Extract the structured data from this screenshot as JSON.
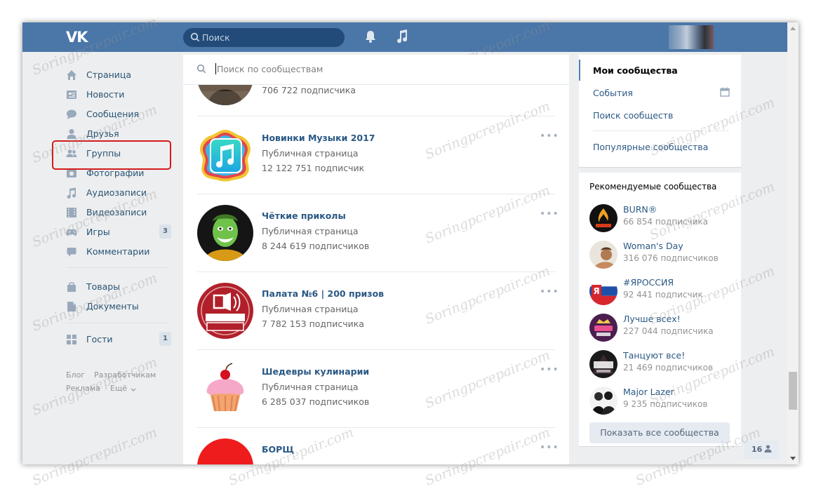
{
  "header": {
    "logo": "VK",
    "search_placeholder": "Поиск"
  },
  "nav": {
    "items": [
      {
        "label": "Страница",
        "icon": "home-icon",
        "y": 0
      },
      {
        "label": "Новости",
        "icon": "news-icon"
      },
      {
        "label": "Сообщения",
        "icon": "messages-icon"
      },
      {
        "label": "Друзья",
        "icon": "friends-icon"
      },
      {
        "label": "Группы",
        "icon": "groups-icon"
      },
      {
        "label": "Фотографии",
        "icon": "photos-icon"
      },
      {
        "label": "Аудиозаписи",
        "icon": "music-icon"
      },
      {
        "label": "Видеозаписи",
        "icon": "video-icon"
      },
      {
        "label": "Игры",
        "icon": "games-icon",
        "badge": "3"
      },
      {
        "label": "Комментарии",
        "icon": "comments-icon"
      },
      {
        "label": "Товары",
        "icon": "goods-icon"
      },
      {
        "label": "Документы",
        "icon": "documents-icon"
      },
      {
        "label": "Гости",
        "icon": "guests-icon",
        "badge": "1"
      }
    ],
    "footer": {
      "blog": "Блог",
      "developers": "Разработчикам",
      "ads": "Реклама",
      "more": "Ещё"
    }
  },
  "main": {
    "search_placeholder": "Поиск по сообществам",
    "communities": [
      {
        "name": "",
        "type": "Публичная страница",
        "subs": "706 722 подписчика"
      },
      {
        "name": "Новинки Музыки 2017",
        "type": "Публичная страница",
        "subs": "12 122 751 подписчик"
      },
      {
        "name": "Чёткие приколы",
        "type": "Публичная страница",
        "subs": "8 244 619 подписчиков"
      },
      {
        "name": "Палата №6 | 200 призов",
        "type": "Публичная страница",
        "subs": "7 782 153 подписчика"
      },
      {
        "name": "Шедевры кулинарии",
        "type": "Публичная страница",
        "subs": "6 285 037 подписчиков"
      },
      {
        "name": "БОРЩ",
        "type": "",
        "subs": ""
      }
    ],
    "more_glyph": "•••"
  },
  "right_menu": {
    "my": "Мои сообщества",
    "events": "События",
    "search": "Поиск сообществ",
    "popular": "Популярные сообщества"
  },
  "recommended": {
    "title": "Рекомендуемые сообщества",
    "items": [
      {
        "name": "BURN®",
        "subs": "66 854 подписчика"
      },
      {
        "name": "Woman's Day",
        "subs": "316 076 подписчиков"
      },
      {
        "name": "#ЯРОССИЯ",
        "subs": "92 441 подписчик"
      },
      {
        "name": "Лучше всех!",
        "subs": "227 044 подписчика"
      },
      {
        "name": "Танцуют все!",
        "subs": "21 469 подписчиков"
      },
      {
        "name": "Major Lazer",
        "subs": "9 235 подписчиков"
      }
    ],
    "show_all": "Показать все сообщества"
  },
  "online_count": "16",
  "watermark": "Soringpcrepair.com"
}
